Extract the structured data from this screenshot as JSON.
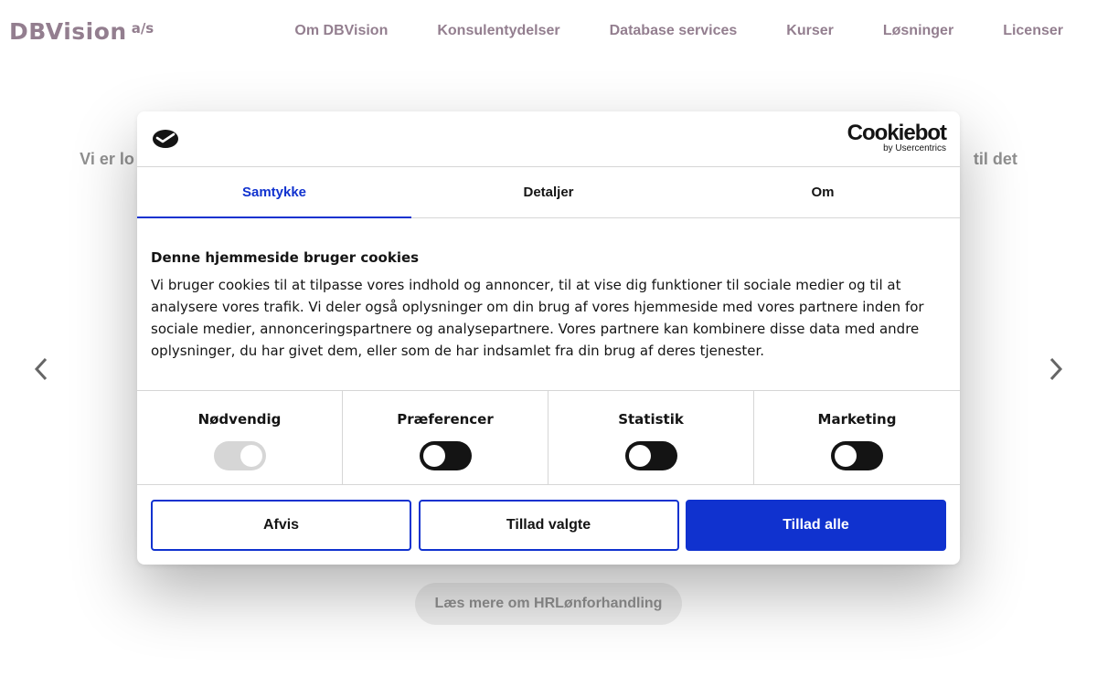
{
  "header": {
    "logo_word": "DBVision",
    "logo_suffix": "a/s",
    "nav": [
      {
        "label": "Om DBVision"
      },
      {
        "label": "Konsulentydelser"
      },
      {
        "label": "Database services"
      },
      {
        "label": "Kurser"
      },
      {
        "label": "Løsninger"
      },
      {
        "label": "Licenser"
      }
    ]
  },
  "hero": {
    "subtitle_left": "Vi er lo",
    "subtitle_right": "til det",
    "read_more_label": "Læs mere om HRLønforhandling"
  },
  "cookie_dialog": {
    "brand_main": "Cookiebot",
    "brand_sub": "by Usercentrics",
    "tabs": [
      {
        "label": "Samtykke",
        "active": true
      },
      {
        "label": "Detaljer",
        "active": false
      },
      {
        "label": "Om",
        "active": false
      }
    ],
    "heading": "Denne hjemmeside bruger cookies",
    "body": "Vi bruger cookies til at tilpasse vores indhold og annoncer, til at vise dig funktioner til sociale medier og til at analysere vores trafik. Vi deler også oplysninger om din brug af vores hjemmeside med vores partnere inden for sociale medier, annonceringspartnere og analysepartnere. Vores partnere kan kombinere disse data med andre oplysninger, du har givet dem, eller som de har indsamlet fra din brug af deres tjenester.",
    "toggles": [
      {
        "label": "Nødvendig",
        "state": "on-disabled"
      },
      {
        "label": "Præferencer",
        "state": "off"
      },
      {
        "label": "Statistik",
        "state": "off"
      },
      {
        "label": "Marketing",
        "state": "off"
      }
    ],
    "buttons": {
      "deny": "Afvis",
      "allow_selected": "Tillad valgte",
      "allow_all": "Tillad alle"
    },
    "colors": {
      "accent": "#1032cf",
      "toggle_off": "#141414",
      "toggle_disabled": "#d6d6d6"
    }
  },
  "colors": {
    "brand": "#5a3a53",
    "read_more_bg": "#e4e4e4"
  }
}
